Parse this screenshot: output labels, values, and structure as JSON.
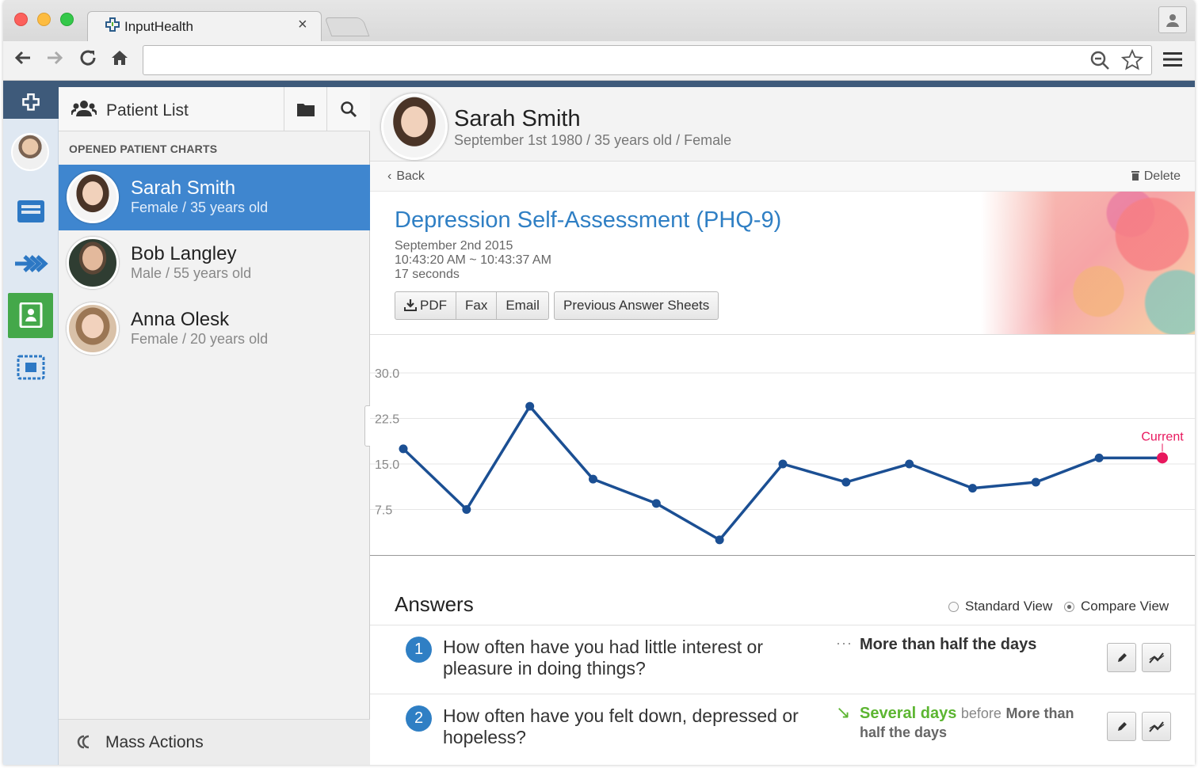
{
  "browser": {
    "tab_title": "InputHealth",
    "close_glyph": "×",
    "url": ""
  },
  "icons": {
    "back": "arrow-left-icon",
    "forward": "arrow-right-icon",
    "reload": "reload-icon",
    "home": "home-icon",
    "zoom": "zoom-icon",
    "star": "star-icon",
    "menu": "hamburger-menu-icon"
  },
  "colors": {
    "accent_blue": "#2f7fc4",
    "selected_row": "#3f86cf",
    "active_rail": "#44a84a",
    "chart_line": "#1b4f93",
    "current_point": "#e8175d",
    "improved_green": "#5cb531"
  },
  "patient_list": {
    "title": "Patient List",
    "section_label": "OPENED PATIENT CHARTS",
    "patients": [
      {
        "name": "Sarah Smith",
        "sub": "Female / 35 years old"
      },
      {
        "name": "Bob Langley",
        "sub": "Male / 55 years old"
      },
      {
        "name": "Anna Olesk",
        "sub": "Female / 20 years old"
      }
    ],
    "mass_actions": "Mass Actions"
  },
  "patient": {
    "name": "Sarah Smith",
    "details": "September 1st 1980 / 35 years old / Female"
  },
  "nav": {
    "back": "Back",
    "delete": "Delete"
  },
  "assessment": {
    "title": "Depression Self-Assessment (PHQ-9)",
    "date": "September 2nd 2015",
    "time": "10:43:20 AM ~ 10:43:37 AM",
    "duration": "17 seconds",
    "buttons": {
      "pdf": "PDF",
      "fax": "Fax",
      "email": "Email",
      "previous": "Previous Answer Sheets"
    }
  },
  "chart_data": {
    "type": "line",
    "y_ticks": [
      "30.0",
      "22.5",
      "15.0",
      "7.5"
    ],
    "ylim": [
      0,
      30
    ],
    "series": [
      {
        "values": [
          17.5,
          7.5,
          24.5,
          12.5,
          8.5,
          2.5,
          15.0,
          12.0,
          15.0,
          11.0,
          12.0,
          16.0,
          16.0
        ]
      }
    ],
    "current_label": "Current",
    "grid": true
  },
  "answers": {
    "title": "Answers",
    "standard_view": "Standard View",
    "compare_view": "Compare View",
    "questions": [
      {
        "num": "1",
        "text": "How often have you had little interest or pleasure in doing things?",
        "trend": "···",
        "answer": "More than half the days"
      },
      {
        "num": "2",
        "text": "How often have you felt down, depressed or hopeless?",
        "trend": "↘",
        "answer": "Several days",
        "before_word": "before",
        "previous": "More than half the days"
      }
    ]
  }
}
